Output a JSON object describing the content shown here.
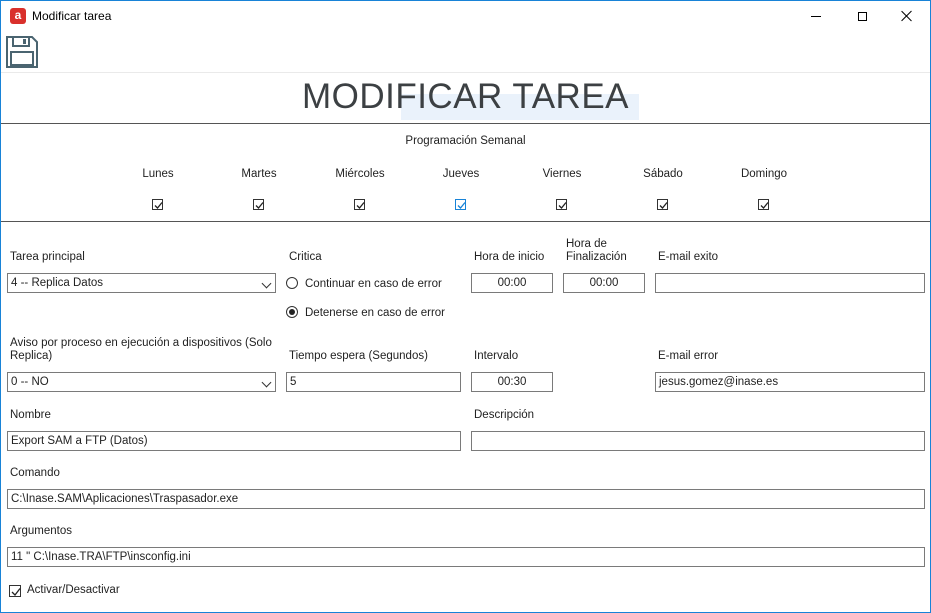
{
  "window": {
    "title": "Modificar tarea"
  },
  "toolbar": {
    "save_icon": "floppy-disk-icon"
  },
  "page_title": "MODIFICAR TAREA",
  "schedule": {
    "title": "Programación Semanal",
    "days": [
      {
        "label": "Lunes",
        "checked": true
      },
      {
        "label": "Martes",
        "checked": true
      },
      {
        "label": "Miércoles",
        "checked": true
      },
      {
        "label": "Jueves",
        "checked": true
      },
      {
        "label": "Viernes",
        "checked": true
      },
      {
        "label": "Sábado",
        "checked": true
      },
      {
        "label": "Domingo",
        "checked": true
      }
    ]
  },
  "form": {
    "tarea_principal": {
      "label": "Tarea principal",
      "value": "4 -- Replica Datos"
    },
    "critica": {
      "label": "Critica",
      "options": [
        {
          "label": "Continuar en caso de error",
          "selected": false
        },
        {
          "label": "Detenerse en caso de error",
          "selected": true
        }
      ]
    },
    "hora_inicio": {
      "label": "Hora de inicio",
      "value": "00:00"
    },
    "hora_fin": {
      "label_line1": "Hora de",
      "label_line2": "Finalización",
      "value": "00:00"
    },
    "email_exito": {
      "label": "E-mail exito",
      "value": ""
    },
    "aviso": {
      "label_line1": "Aviso por proceso en ejecución a dispositivos (Solo",
      "label_line2": "Replica)",
      "value": "0 -- NO"
    },
    "tiempo_espera": {
      "label": "Tiempo espera (Segundos)",
      "value": "5"
    },
    "intervalo": {
      "label": "Intervalo",
      "value": "00:30"
    },
    "email_error": {
      "label": "E-mail error",
      "value": "jesus.gomez@inase.es"
    },
    "nombre": {
      "label": "Nombre",
      "value": "Export SAM a FTP (Datos)"
    },
    "descripcion": {
      "label": "Descripción",
      "value": ""
    },
    "comando": {
      "label": "Comando",
      "value": "C:\\Inase.SAM\\Aplicaciones\\Traspasador.exe"
    },
    "argumentos": {
      "label": "Argumentos",
      "value": "11 \" C:\\Inase.TRA\\FTP\\insconfig.ini"
    },
    "activar": {
      "label": "Activar/Desactivar",
      "checked": true
    }
  }
}
